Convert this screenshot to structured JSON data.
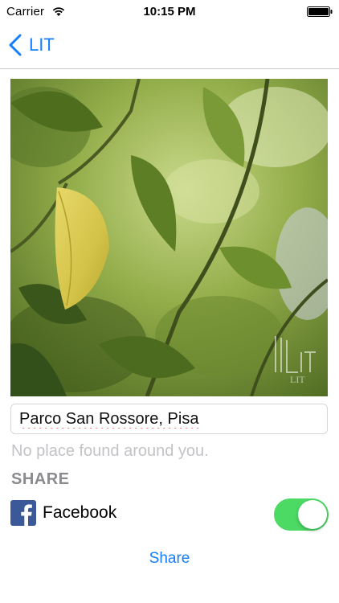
{
  "status_bar": {
    "carrier": "Carrier",
    "time": "10:15 PM"
  },
  "nav": {
    "back_label": "LIT"
  },
  "photo": {
    "watermark": "LIT"
  },
  "location": {
    "value": "Parco San Rossore, Pisa"
  },
  "messages": {
    "no_place": "No place found around you."
  },
  "share_section": {
    "title": "SHARE",
    "facebook_label": "Facebook",
    "facebook_enabled": true,
    "share_button": "Share"
  },
  "colors": {
    "accent": "#157efb",
    "toggle_on": "#4cd964",
    "facebook": "#3b5998"
  }
}
